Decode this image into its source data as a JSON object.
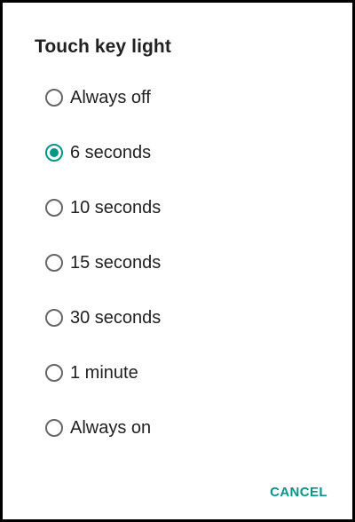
{
  "dialog": {
    "title": "Touch key light",
    "options": [
      {
        "label": "Always off",
        "selected": false
      },
      {
        "label": "6 seconds",
        "selected": true
      },
      {
        "label": "10 seconds",
        "selected": false
      },
      {
        "label": "15 seconds",
        "selected": false
      },
      {
        "label": "30 seconds",
        "selected": false
      },
      {
        "label": "1 minute",
        "selected": false
      },
      {
        "label": "Always on",
        "selected": false
      }
    ],
    "cancel_label": "CANCEL"
  },
  "colors": {
    "accent": "#009688",
    "text": "#212121",
    "radio_unchecked": "#666666",
    "frame": "#000000"
  },
  "icons": {
    "radio_selected": "radio-selected-icon",
    "radio_unselected": "radio-unselected-icon"
  }
}
